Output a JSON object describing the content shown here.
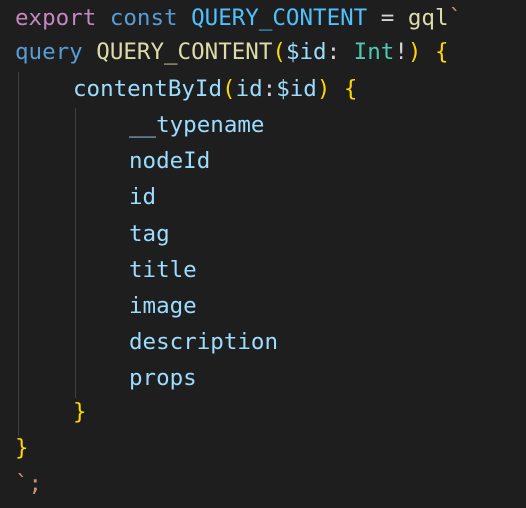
{
  "code": {
    "line1": {
      "export": "export",
      "const": "const",
      "name": "QUERY_CONTENT",
      "eq": " = ",
      "tag": "gql",
      "tick": "`"
    },
    "line2": {
      "keyword": "query",
      "name": "QUERY_CONTENT",
      "open_paren": "(",
      "var": "$id",
      "colon": ": ",
      "type": "Int",
      "bang": "!",
      "close_paren": ")",
      "brace": " {"
    },
    "line3": {
      "field": "contentById",
      "open_paren": "(",
      "arg": "id",
      "colon": ":",
      "var": "$id",
      "close_paren": ")",
      "brace": " {"
    },
    "fields": [
      "__typename",
      "nodeId",
      "id",
      "tag",
      "title",
      "image",
      "description",
      "props"
    ],
    "inner_close": "}",
    "outer_close": "}",
    "end": "`;"
  }
}
